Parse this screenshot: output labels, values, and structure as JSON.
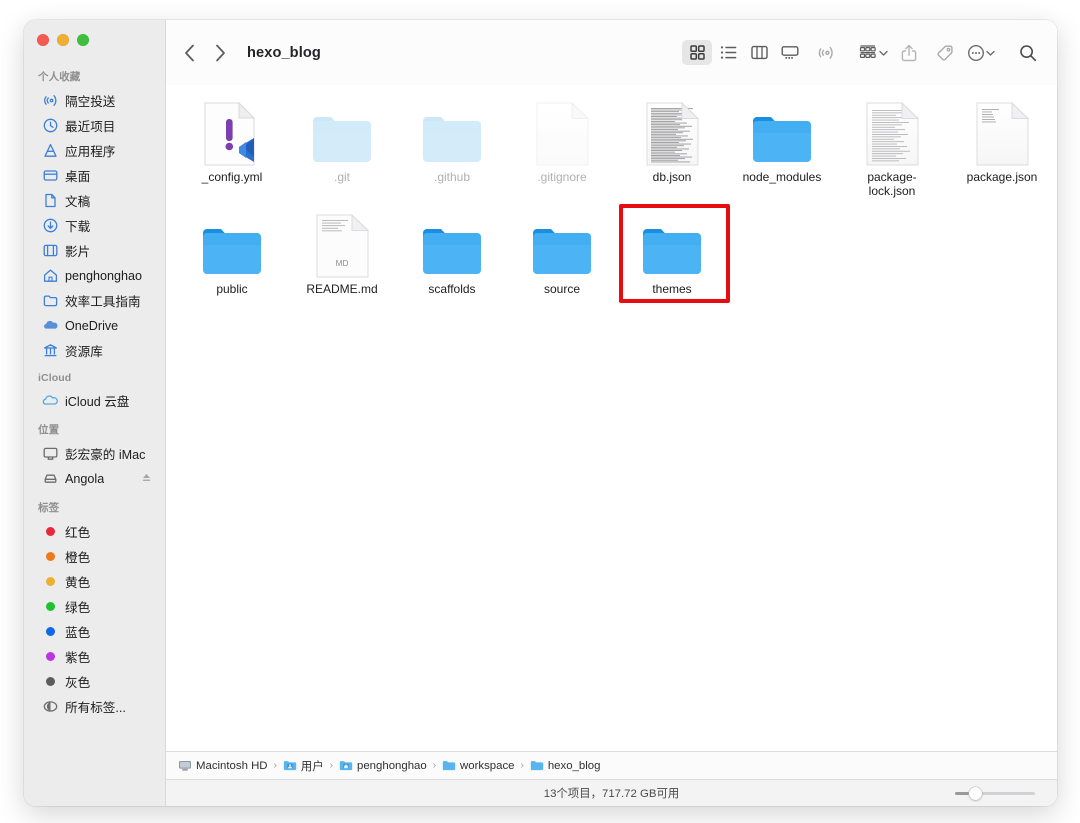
{
  "window": {
    "title": "hexo_blog",
    "traffic_lights": [
      "close",
      "minimize",
      "maximize"
    ]
  },
  "toolbar": {
    "back_label": "‹",
    "forward_label": "›",
    "view_buttons": [
      {
        "name": "icon-view",
        "active": true
      },
      {
        "name": "list-view",
        "active": false
      },
      {
        "name": "column-view",
        "active": false
      },
      {
        "name": "gallery-view",
        "active": false
      }
    ],
    "airdrop_label": "airdrop-icon",
    "group_label": "group-by-icon",
    "share_label": "share-icon",
    "tag_label": "tag-icon",
    "more_label": "more-icon",
    "search_label": "search-icon"
  },
  "sidebar": {
    "sections": [
      {
        "title": "个人收藏",
        "items": [
          {
            "label": "隔空投送",
            "icon": "airdrop-icon"
          },
          {
            "label": "最近项目",
            "icon": "clock-icon"
          },
          {
            "label": "应用程序",
            "icon": "applications-icon"
          },
          {
            "label": "桌面",
            "icon": "desktop-icon"
          },
          {
            "label": "文稿",
            "icon": "document-icon"
          },
          {
            "label": "下载",
            "icon": "downloads-icon"
          },
          {
            "label": "影片",
            "icon": "movies-icon"
          },
          {
            "label": "penghonghao",
            "icon": "home-icon"
          },
          {
            "label": "效率工具指南",
            "icon": "folder-icon"
          },
          {
            "label": "OneDrive",
            "icon": "cloud-icon"
          },
          {
            "label": "资源库",
            "icon": "library-icon"
          }
        ]
      },
      {
        "title": "iCloud",
        "items": [
          {
            "label": "iCloud 云盘",
            "icon": "icloud-icon"
          }
        ]
      },
      {
        "title": "位置",
        "items": [
          {
            "label": "彭宏豪的 iMac",
            "icon": "imac-icon"
          },
          {
            "label": "Angola",
            "icon": "drive-icon",
            "eject": true
          }
        ]
      },
      {
        "title": "标签",
        "items": [
          {
            "label": "红色",
            "icon": "tag-dot",
            "color": "#e8283c"
          },
          {
            "label": "橙色",
            "icon": "tag-dot",
            "color": "#f07818"
          },
          {
            "label": "黄色",
            "icon": "tag-dot",
            "color": "#efb030"
          },
          {
            "label": "绿色",
            "icon": "tag-dot",
            "color": "#1fc12e"
          },
          {
            "label": "蓝色",
            "icon": "tag-dot",
            "color": "#1068e8"
          },
          {
            "label": "紫色",
            "icon": "tag-dot",
            "color": "#bc35e0"
          },
          {
            "label": "灰色",
            "icon": "tag-dot",
            "color": "#5c5c5e"
          },
          {
            "label": "所有标签...",
            "icon": "all-tags-icon"
          }
        ]
      }
    ]
  },
  "files": [
    {
      "name": "_config.yml",
      "type": "yml-vscode",
      "hidden": false
    },
    {
      "name": ".git",
      "type": "folder",
      "hidden": true
    },
    {
      "name": ".github",
      "type": "folder",
      "hidden": true
    },
    {
      "name": ".gitignore",
      "type": "blank-doc",
      "hidden": true
    },
    {
      "name": "db.json",
      "type": "text-doc-dense",
      "hidden": false
    },
    {
      "name": "node_modules",
      "type": "folder",
      "hidden": false
    },
    {
      "name": "package-lock.json",
      "type": "text-doc",
      "hidden": false
    },
    {
      "name": "package.json",
      "type": "text-doc-light",
      "hidden": false
    },
    {
      "name": "public",
      "type": "folder",
      "hidden": false
    },
    {
      "name": "README.md",
      "type": "md-doc",
      "hidden": false,
      "badge": "MD"
    },
    {
      "name": "scaffolds",
      "type": "folder",
      "hidden": false
    },
    {
      "name": "source",
      "type": "folder",
      "hidden": false
    },
    {
      "name": "themes",
      "type": "folder",
      "hidden": false,
      "highlighted": true
    }
  ],
  "pathbar": {
    "items": [
      {
        "label": "Macintosh HD",
        "icon": "hard-drive-icon"
      },
      {
        "label": "用户",
        "icon": "users-folder-icon"
      },
      {
        "label": "penghonghao",
        "icon": "home-folder-icon"
      },
      {
        "label": "workspace",
        "icon": "folder-icon"
      },
      {
        "label": "hexo_blog",
        "icon": "folder-icon"
      }
    ],
    "separator": "›"
  },
  "statusbar": {
    "text": "13个项目，717.72 GB可用",
    "zoom_slider_value": 20
  },
  "annotation": {
    "target": "themes",
    "color": "#e60c10"
  }
}
